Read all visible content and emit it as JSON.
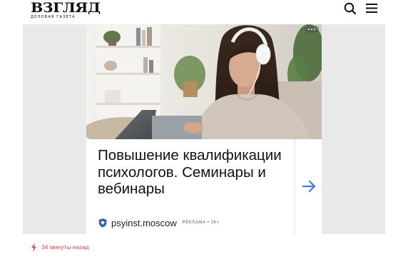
{
  "header": {
    "logo_title": "ВЗГЛЯД",
    "logo_subtitle": "Деловая газета",
    "search_icon": "search-icon",
    "menu_icon": "menu-icon"
  },
  "ad": {
    "headline": "Повышение квалификации психологов. Семинары и вебинары",
    "domain": "psyinst.moscow",
    "label": "РЕКЛАМА • 16+",
    "more_icon": "more-icon",
    "arrow_icon": "arrow-right-icon",
    "photo_description_icon": "ad-photo",
    "colors": {
      "arrow": "#3d7fd8",
      "wall": "#eeeeea",
      "sweater": "#cfc5b8"
    }
  },
  "news": {
    "timestamp": "34 минуты назад",
    "lightning_icon": "lightning-icon",
    "accent_color": "#d9464e"
  }
}
